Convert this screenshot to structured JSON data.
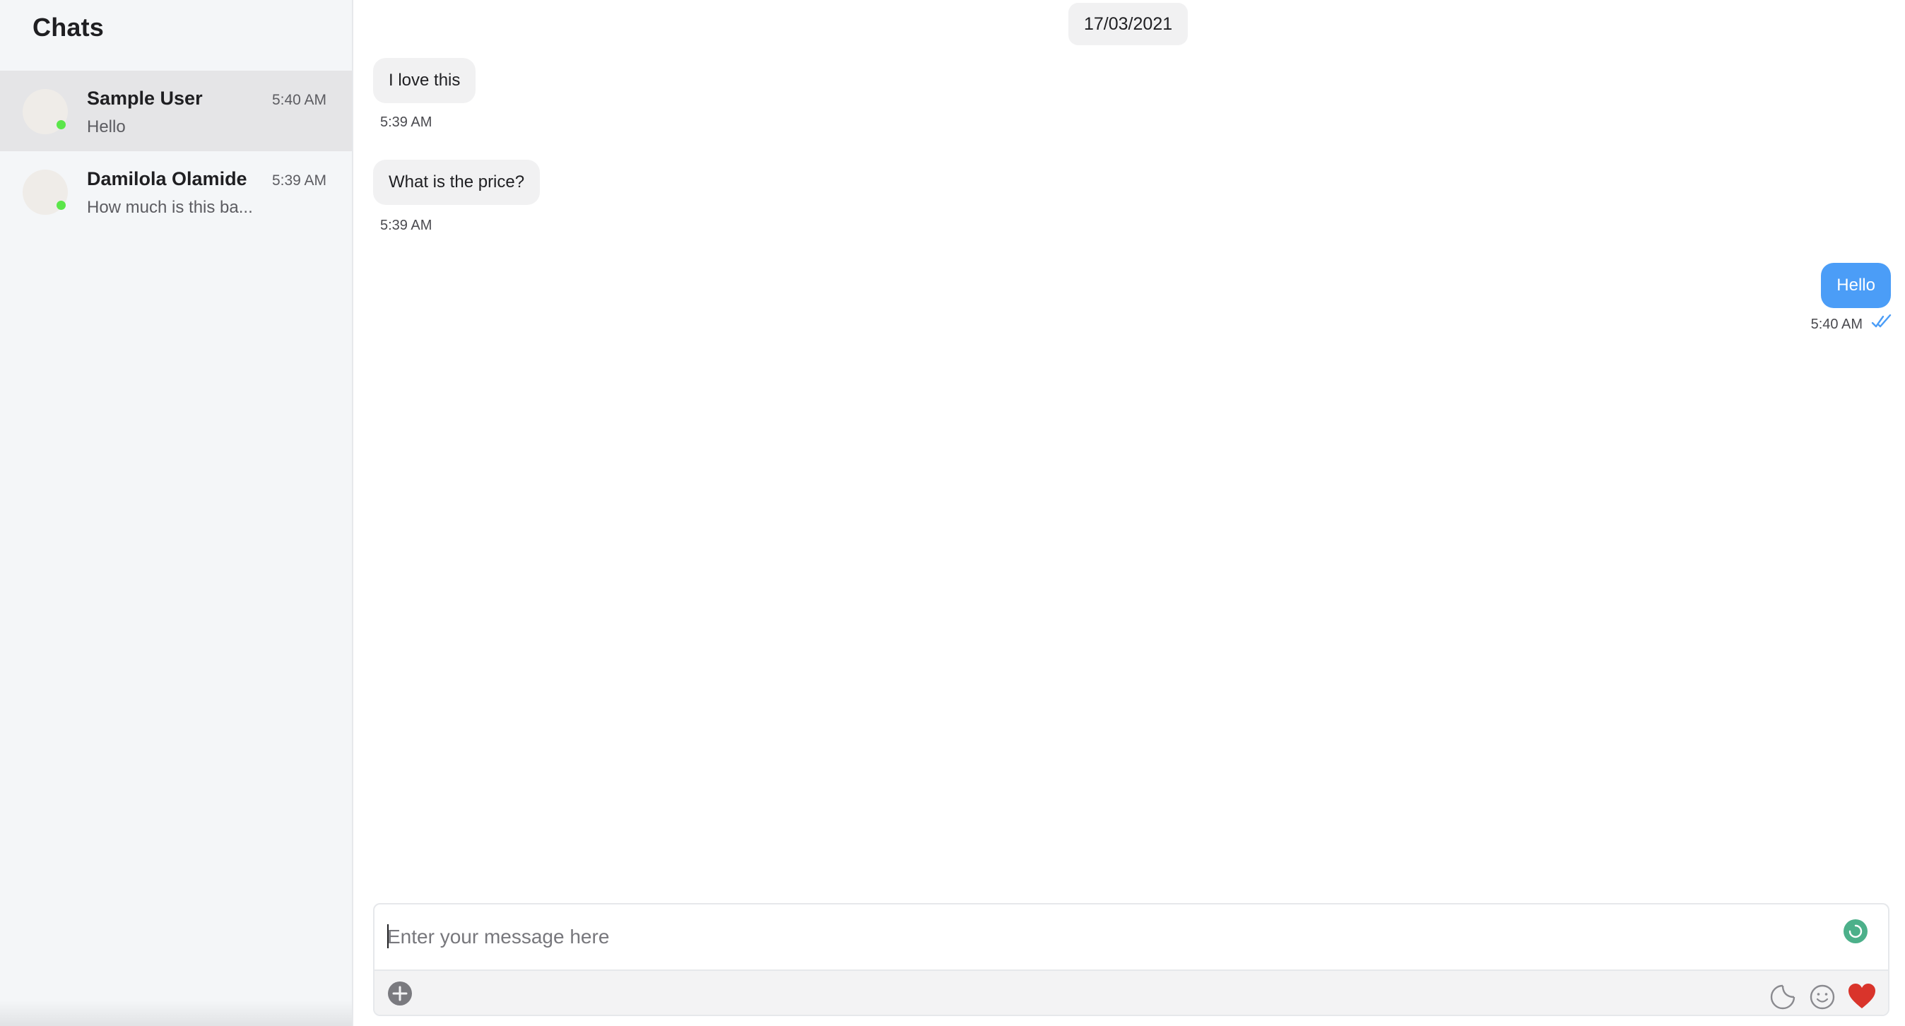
{
  "sidebar": {
    "title": "Chats",
    "chats": [
      {
        "name": "Sample User",
        "time": "5:40 AM",
        "preview": "Hello",
        "active": true,
        "online": true
      },
      {
        "name": "Damilola Olamide",
        "time": "5:39 AM",
        "preview": "How much is this ba...",
        "active": false,
        "online": true
      }
    ]
  },
  "conversation": {
    "date": "17/03/2021",
    "messages": [
      {
        "direction": "in",
        "text": "I love this",
        "time": "5:39 AM"
      },
      {
        "direction": "in",
        "text": "What is the price?",
        "time": "5:39 AM"
      },
      {
        "direction": "out",
        "text": "Hello",
        "time": "5:40 AM",
        "status": "read"
      }
    ]
  },
  "composer": {
    "placeholder": "Enter your message here",
    "value": "",
    "icons": [
      "status-spinner-icon",
      "add-icon",
      "sticker-icon",
      "emoji-icon",
      "heart-icon"
    ]
  },
  "colors": {
    "accent": "#4b9df7",
    "online": "#5be64a",
    "heart": "#d9342b",
    "status": "#4cb08a"
  }
}
